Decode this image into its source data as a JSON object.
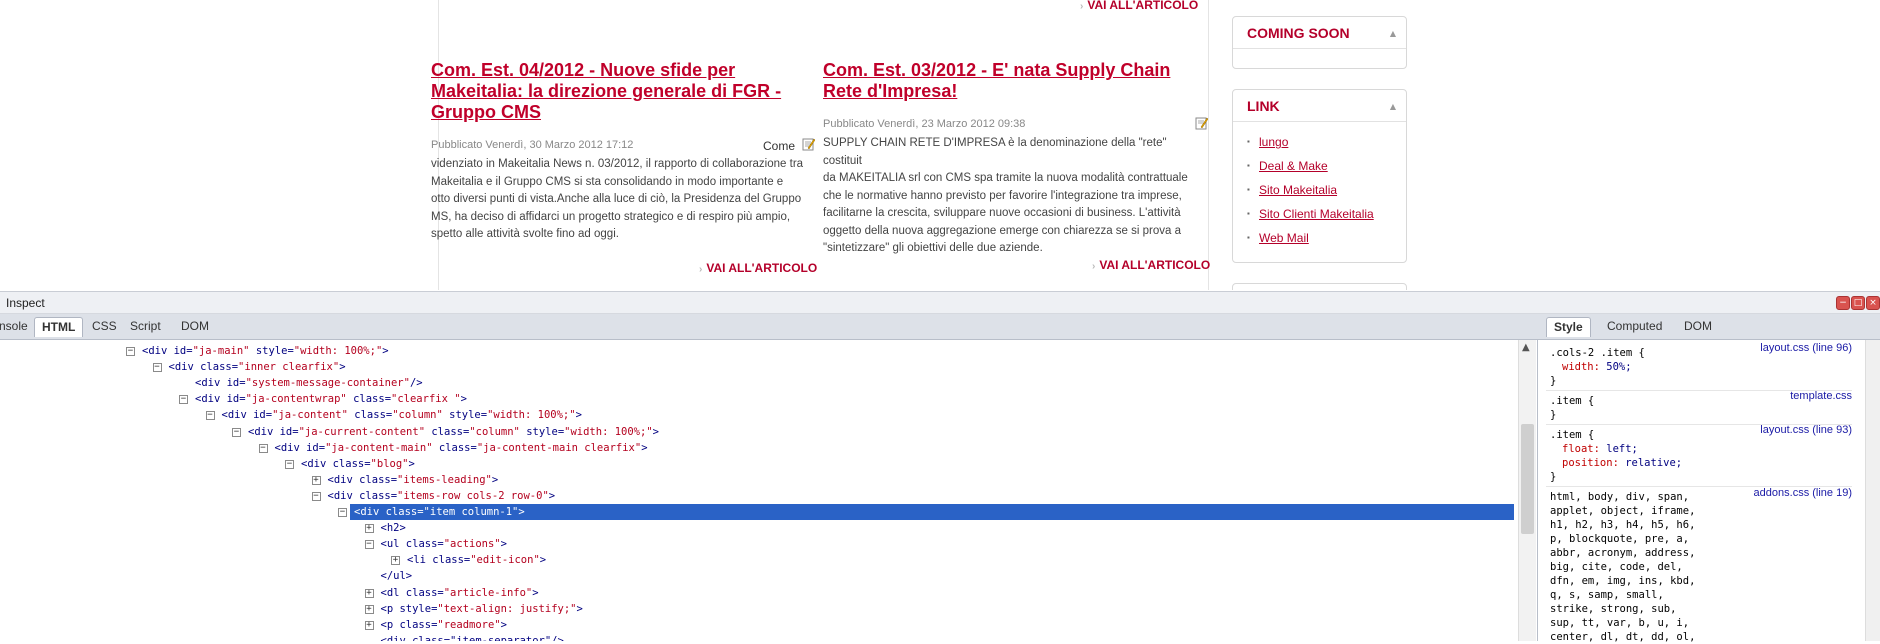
{
  "webpage": {
    "top_readmore": "VAI ALL'ARTICOLO",
    "articles": [
      {
        "title": "Com. Est. 04/2012 - Nuove sfide per Makeitalia: la direzione generale di FGR - Gruppo CMS",
        "meta": "Pubblicato Venerdì, 30 Marzo 2012 17:12",
        "come": "Come",
        "body_lines": [
          "videnziato in Makeitalia News n. 03/2012, il rapporto di collaborazione tra",
          "Makeitalia e il Gruppo CMS si sta consolidando in modo importante e",
          "otto diversi punti di vista.Anche alla luce di ciò, la Presidenza del Gruppo",
          "MS, ha deciso di affidarci un progetto strategico e di respiro più ampio,",
          "spetto alle attività svolte fino ad oggi."
        ],
        "readmore": "VAI ALL'ARTICOLO"
      },
      {
        "title": "Com. Est. 03/2012 - E' nata Supply Chain Rete d'Impresa!",
        "meta": "Pubblicato Venerdì, 23 Marzo 2012 09:38",
        "body_lines": [
          "SUPPLY CHAIN RETE D'IMPRESA è la denominazione della \"rete\" costituit",
          "da MAKEITALIA srl con CMS spa tramite la nuova modalità contrattuale",
          "che le normative hanno previsto per favorire l'integrazione tra imprese,",
          "facilitarne la crescita, sviluppare nuove occasioni di business. L'attività",
          "oggetto della nuova aggregazione emerge con chiarezza se si prova a",
          "\"sintetizzare\" gli obiettivi delle due aziende."
        ],
        "readmore": "VAI ALL'ARTICOLO"
      }
    ],
    "modules": {
      "coming_soon_title": "COMING SOON",
      "link_title": "LINK",
      "links": [
        "lungo",
        "Deal & Make",
        "Sito Makeitalia",
        "Sito Clienti Makeitalia",
        "Web Mail"
      ]
    }
  },
  "firebug": {
    "title": "Inspect",
    "window_buttons": [
      "−",
      "□",
      "×"
    ],
    "tabs": [
      "nsole",
      "HTML",
      "CSS",
      "Script",
      "DOM"
    ],
    "active_tab": "HTML",
    "side_tabs": [
      "Style",
      "Computed",
      "DOM"
    ],
    "active_side_tab": "Style",
    "html_rows": [
      {
        "text": "<div id=\"ja-main\" style=\"width: 100%;\">",
        "toggle": "−"
      },
      {
        "text": "<div class=\"inner clearfix\">",
        "toggle": "−"
      },
      {
        "text": "<div id=\"system-message-container\"/>",
        "toggle": ""
      },
      {
        "text": "<div id=\"ja-contentwrap\" class=\"clearfix \">",
        "toggle": "−"
      },
      {
        "text": "<div id=\"ja-content\" class=\"column\" style=\"width: 100%;\">",
        "toggle": "−"
      },
      {
        "text": "<div id=\"ja-current-content\" class=\"column\" style=\"width: 100%;\">",
        "toggle": "−"
      },
      {
        "text": "<div id=\"ja-content-main\" class=\"ja-content-main clearfix\">",
        "toggle": "−"
      },
      {
        "text": "<div class=\"blog\">",
        "toggle": "−"
      },
      {
        "text": "<div class=\"items-leading\">",
        "toggle": "+"
      },
      {
        "text": "<div class=\"items-row cols-2 row-0\">",
        "toggle": "−"
      },
      {
        "text": "<div class=\"item column-1\">",
        "toggle": "−"
      },
      {
        "text": "<h2>",
        "toggle": "+"
      },
      {
        "text": "<ul class=\"actions\">",
        "toggle": "−"
      },
      {
        "text": "<li class=\"edit-icon\">",
        "toggle": "+"
      },
      {
        "text": "</ul>",
        "toggle": ""
      },
      {
        "text": "<dl class=\"article-info\">",
        "toggle": "+"
      },
      {
        "text": "<p style=\"text-align: justify;\">",
        "toggle": "+"
      },
      {
        "text": "<p class=\"readmore\">",
        "toggle": "+"
      },
      {
        "text": "<div class=\"item-separator\"/>",
        "toggle": ""
      }
    ],
    "style_rules": [
      {
        "selector": ".cols-2 .item {",
        "props": [
          [
            "width",
            "50%;"
          ]
        ],
        "source": "layout.css (line 96)"
      },
      {
        "selector": ".item {",
        "props": [],
        "source": "template.css"
      },
      {
        "selector": ".item {",
        "props": [
          [
            "float",
            "left;"
          ],
          [
            "position",
            "relative;"
          ]
        ],
        "source": "layout.css (line 93)"
      }
    ],
    "reset_rule": {
      "source": "addons.css (line 19)",
      "lines": [
        "html, body, div, span,",
        "applet, object, iframe,",
        "h1, h2, h3, h4, h5, h6,",
        "p, blockquote, pre, a,",
        "abbr, acronym, address,",
        "big, cite, code, del,",
        "dfn, em, img, ins, kbd,",
        "q, s, samp, small,",
        "strike, strong, sub,",
        "sup, tt, var, b, u, i,",
        "center, dl, dt, dd, ol,"
      ]
    }
  }
}
